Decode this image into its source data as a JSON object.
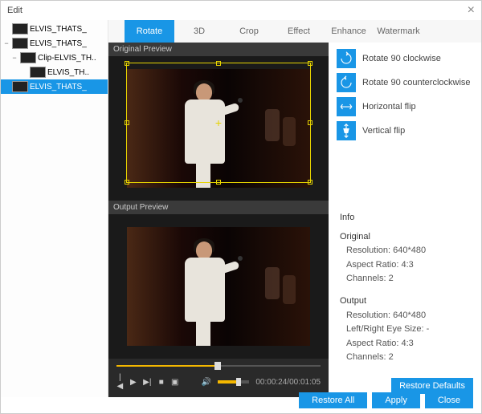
{
  "window": {
    "title": "Edit",
    "close": "×"
  },
  "tree": [
    {
      "label": "ELVIS_THATS_",
      "level": 0,
      "toggle": ""
    },
    {
      "label": "ELVIS_THATS_",
      "level": 0,
      "toggle": "−"
    },
    {
      "label": "Clip-ELVIS_TH..",
      "level": 1,
      "toggle": "−"
    },
    {
      "label": "ELVIS_TH..",
      "level": 2,
      "toggle": ""
    },
    {
      "label": "ELVIS_THATS_",
      "level": 0,
      "toggle": "",
      "selected": true
    }
  ],
  "tabs": [
    "Rotate",
    "3D",
    "Crop",
    "Effect",
    "Enhance",
    "Watermark"
  ],
  "activeTab": "Rotate",
  "preview": {
    "originalLabel": "Original Preview",
    "outputLabel": "Output Preview"
  },
  "rotate": {
    "opts": [
      {
        "label": "Rotate 90 clockwise",
        "icon": "rot-cw"
      },
      {
        "label": "Rotate 90 counterclockwise",
        "icon": "rot-ccw"
      },
      {
        "label": "Horizontal flip",
        "icon": "flip-h"
      },
      {
        "label": "Vertical flip",
        "icon": "flip-v"
      }
    ]
  },
  "info": {
    "header": "Info",
    "original": {
      "title": "Original",
      "resolution": "Resolution: 640*480",
      "aspect": "Aspect Ratio: 4:3",
      "channels": "Channels: 2"
    },
    "output": {
      "title": "Output",
      "resolution": "Resolution: 640*480",
      "eye": "Left/Right Eye Size: -",
      "aspect": "Aspect Ratio: 4:3",
      "channels": "Channels: 2"
    }
  },
  "player": {
    "time": "00:00:24/00:01:05"
  },
  "buttons": {
    "restoreDefaults": "Restore Defaults",
    "restoreAll": "Restore All",
    "apply": "Apply",
    "close": "Close"
  }
}
